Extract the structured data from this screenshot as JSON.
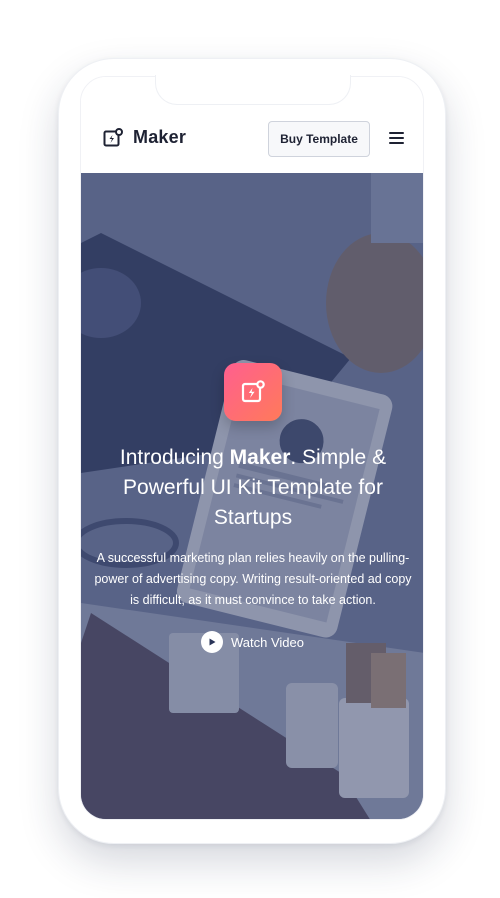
{
  "header": {
    "brand_name": "Maker",
    "buy_button": "Buy Template"
  },
  "hero": {
    "headline_pre": "Introducing ",
    "headline_brand": "Maker",
    "headline_post": ". Simple & Powerful UI Kit Template for Startups",
    "subtext": "A successful marketing plan relies heavily on the pulling-power of advertising copy. Writing result-oriented ad copy is difficult, as it must convince to take action.",
    "watch_label": "Watch Video"
  },
  "colors": {
    "accent_gradient_start": "#ff5f8f",
    "accent_gradient_end": "#ff7a5a",
    "overlay": "#28345c",
    "text_dark": "#1e2233"
  },
  "icons": {
    "brand": "maker-logo-icon",
    "menu": "hamburger-menu-icon",
    "play": "play-icon"
  }
}
